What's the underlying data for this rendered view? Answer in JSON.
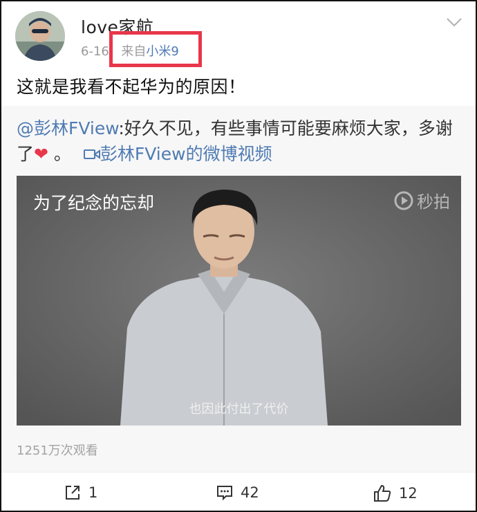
{
  "post": {
    "username": "love家航",
    "date": "6-16",
    "source_prefix": "来自",
    "device": "小米9",
    "text": "这就是我看不起华为的原因！"
  },
  "repost": {
    "mention": "@彭林FView",
    "text": ":好久不见，有些事情可能要麻烦大家，多谢了",
    "after_heart": " 。",
    "video_link": "彭林FView的微博视频",
    "video": {
      "title": "为了纪念的忘却",
      "watermark": "秒拍",
      "subtitle": "也因此付出了代价"
    },
    "views": "1251万次观看"
  },
  "actions": {
    "share_count": "1",
    "comment_count": "42",
    "like_count": "12"
  },
  "icons": {
    "avatar": "avatar",
    "menu": "chevron-down-icon",
    "heart": "heart-emoji",
    "video": "video-camera-icon",
    "share": "share-icon",
    "comment": "comment-icon",
    "like": "thumbs-up-icon"
  },
  "colors": {
    "link": "#4f7bb3",
    "highlight": "#e8364a"
  }
}
